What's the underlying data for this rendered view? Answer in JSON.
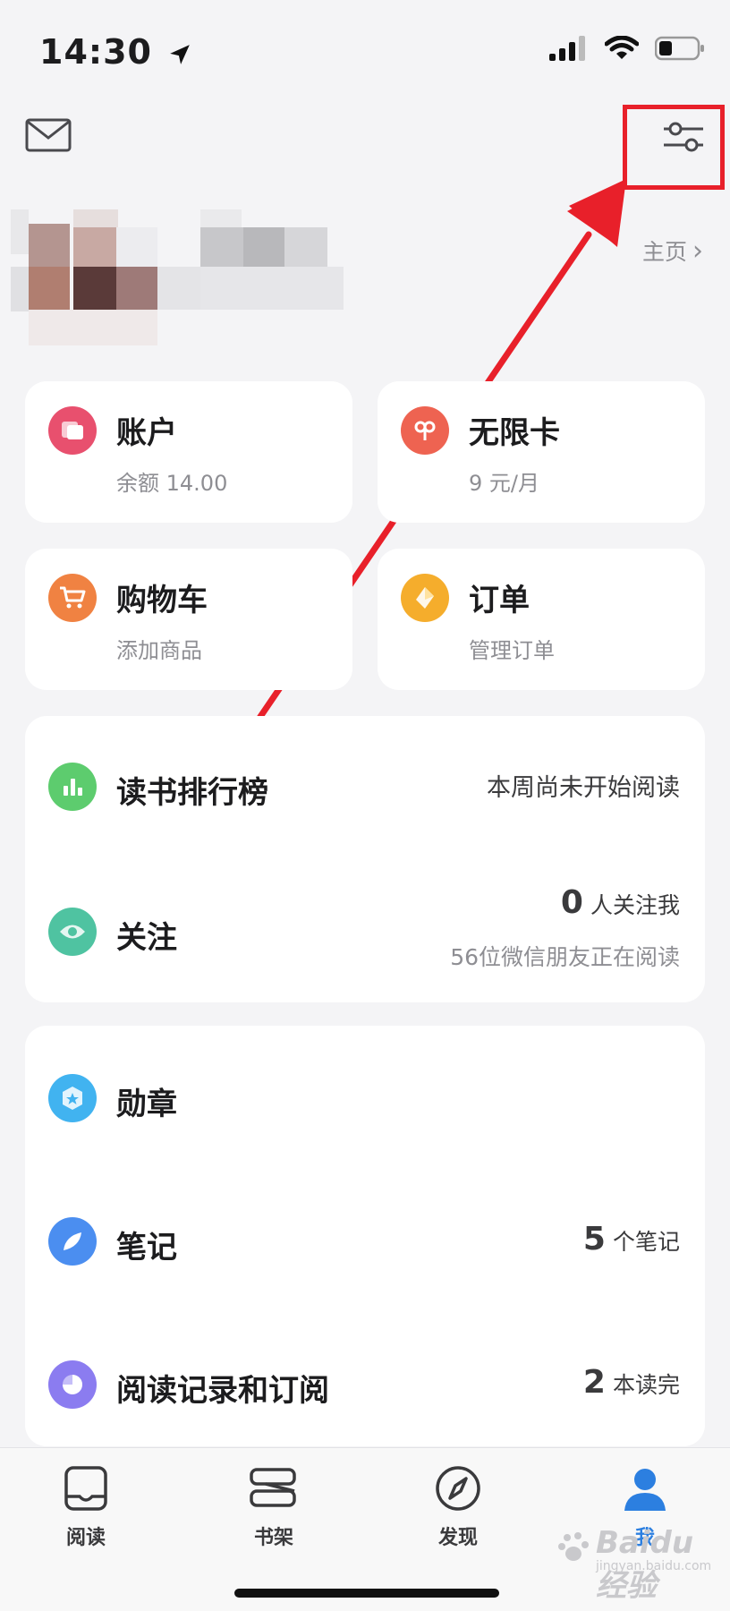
{
  "status_bar": {
    "time": "14:30"
  },
  "header": {
    "home_link": "主页",
    "home_chevron": "›"
  },
  "grid_cards": [
    {
      "title": "账户",
      "subtitle": "余额 14.00",
      "icon": "account-icon",
      "color": "#e8506e"
    },
    {
      "title": "无限卡",
      "subtitle": "9 元/月",
      "icon": "infinite-card-icon",
      "color": "#ee6351"
    },
    {
      "title": "购物车",
      "subtitle": "添加商品",
      "icon": "cart-icon",
      "color": "#f08242"
    },
    {
      "title": "订单",
      "subtitle": "管理订单",
      "icon": "order-icon",
      "color": "#f5ad2c"
    }
  ],
  "section1": {
    "ranking": {
      "title": "读书排行榜",
      "right_text": "本周尚未开始阅读",
      "icon": "chart-bars-icon",
      "color": "#5dcc6e"
    },
    "follow": {
      "title": "关注",
      "count": "0",
      "count_unit": "人关注我",
      "sub": "56位微信朋友正在阅读",
      "icon": "eye-icon",
      "color": "#4fc3a1"
    }
  },
  "section2": {
    "badges": {
      "title": "勋章",
      "icon": "badge-icon",
      "color": "#41b3f0"
    },
    "notes": {
      "title": "笔记",
      "count": "5",
      "count_unit": "个笔记",
      "icon": "feather-icon",
      "color": "#4b8ef0"
    },
    "history": {
      "title": "阅读记录和订阅",
      "count": "2",
      "count_unit": "本读完",
      "icon": "history-icon",
      "color": "#8b7cf0"
    }
  },
  "bottom_nav": [
    {
      "label": "阅读",
      "icon": "read-icon",
      "active": false
    },
    {
      "label": "书架",
      "icon": "bookshelf-icon",
      "active": false
    },
    {
      "label": "发现",
      "icon": "compass-icon",
      "active": false
    },
    {
      "label": "我",
      "icon": "person-icon",
      "active": true
    }
  ],
  "watermark": {
    "text": "Baidu经验",
    "sub": "jingyan.baidu.com"
  },
  "colors": {
    "accent": "#2c7fe0",
    "highlight": "#e8202a",
    "background": "#f4f4f6"
  }
}
